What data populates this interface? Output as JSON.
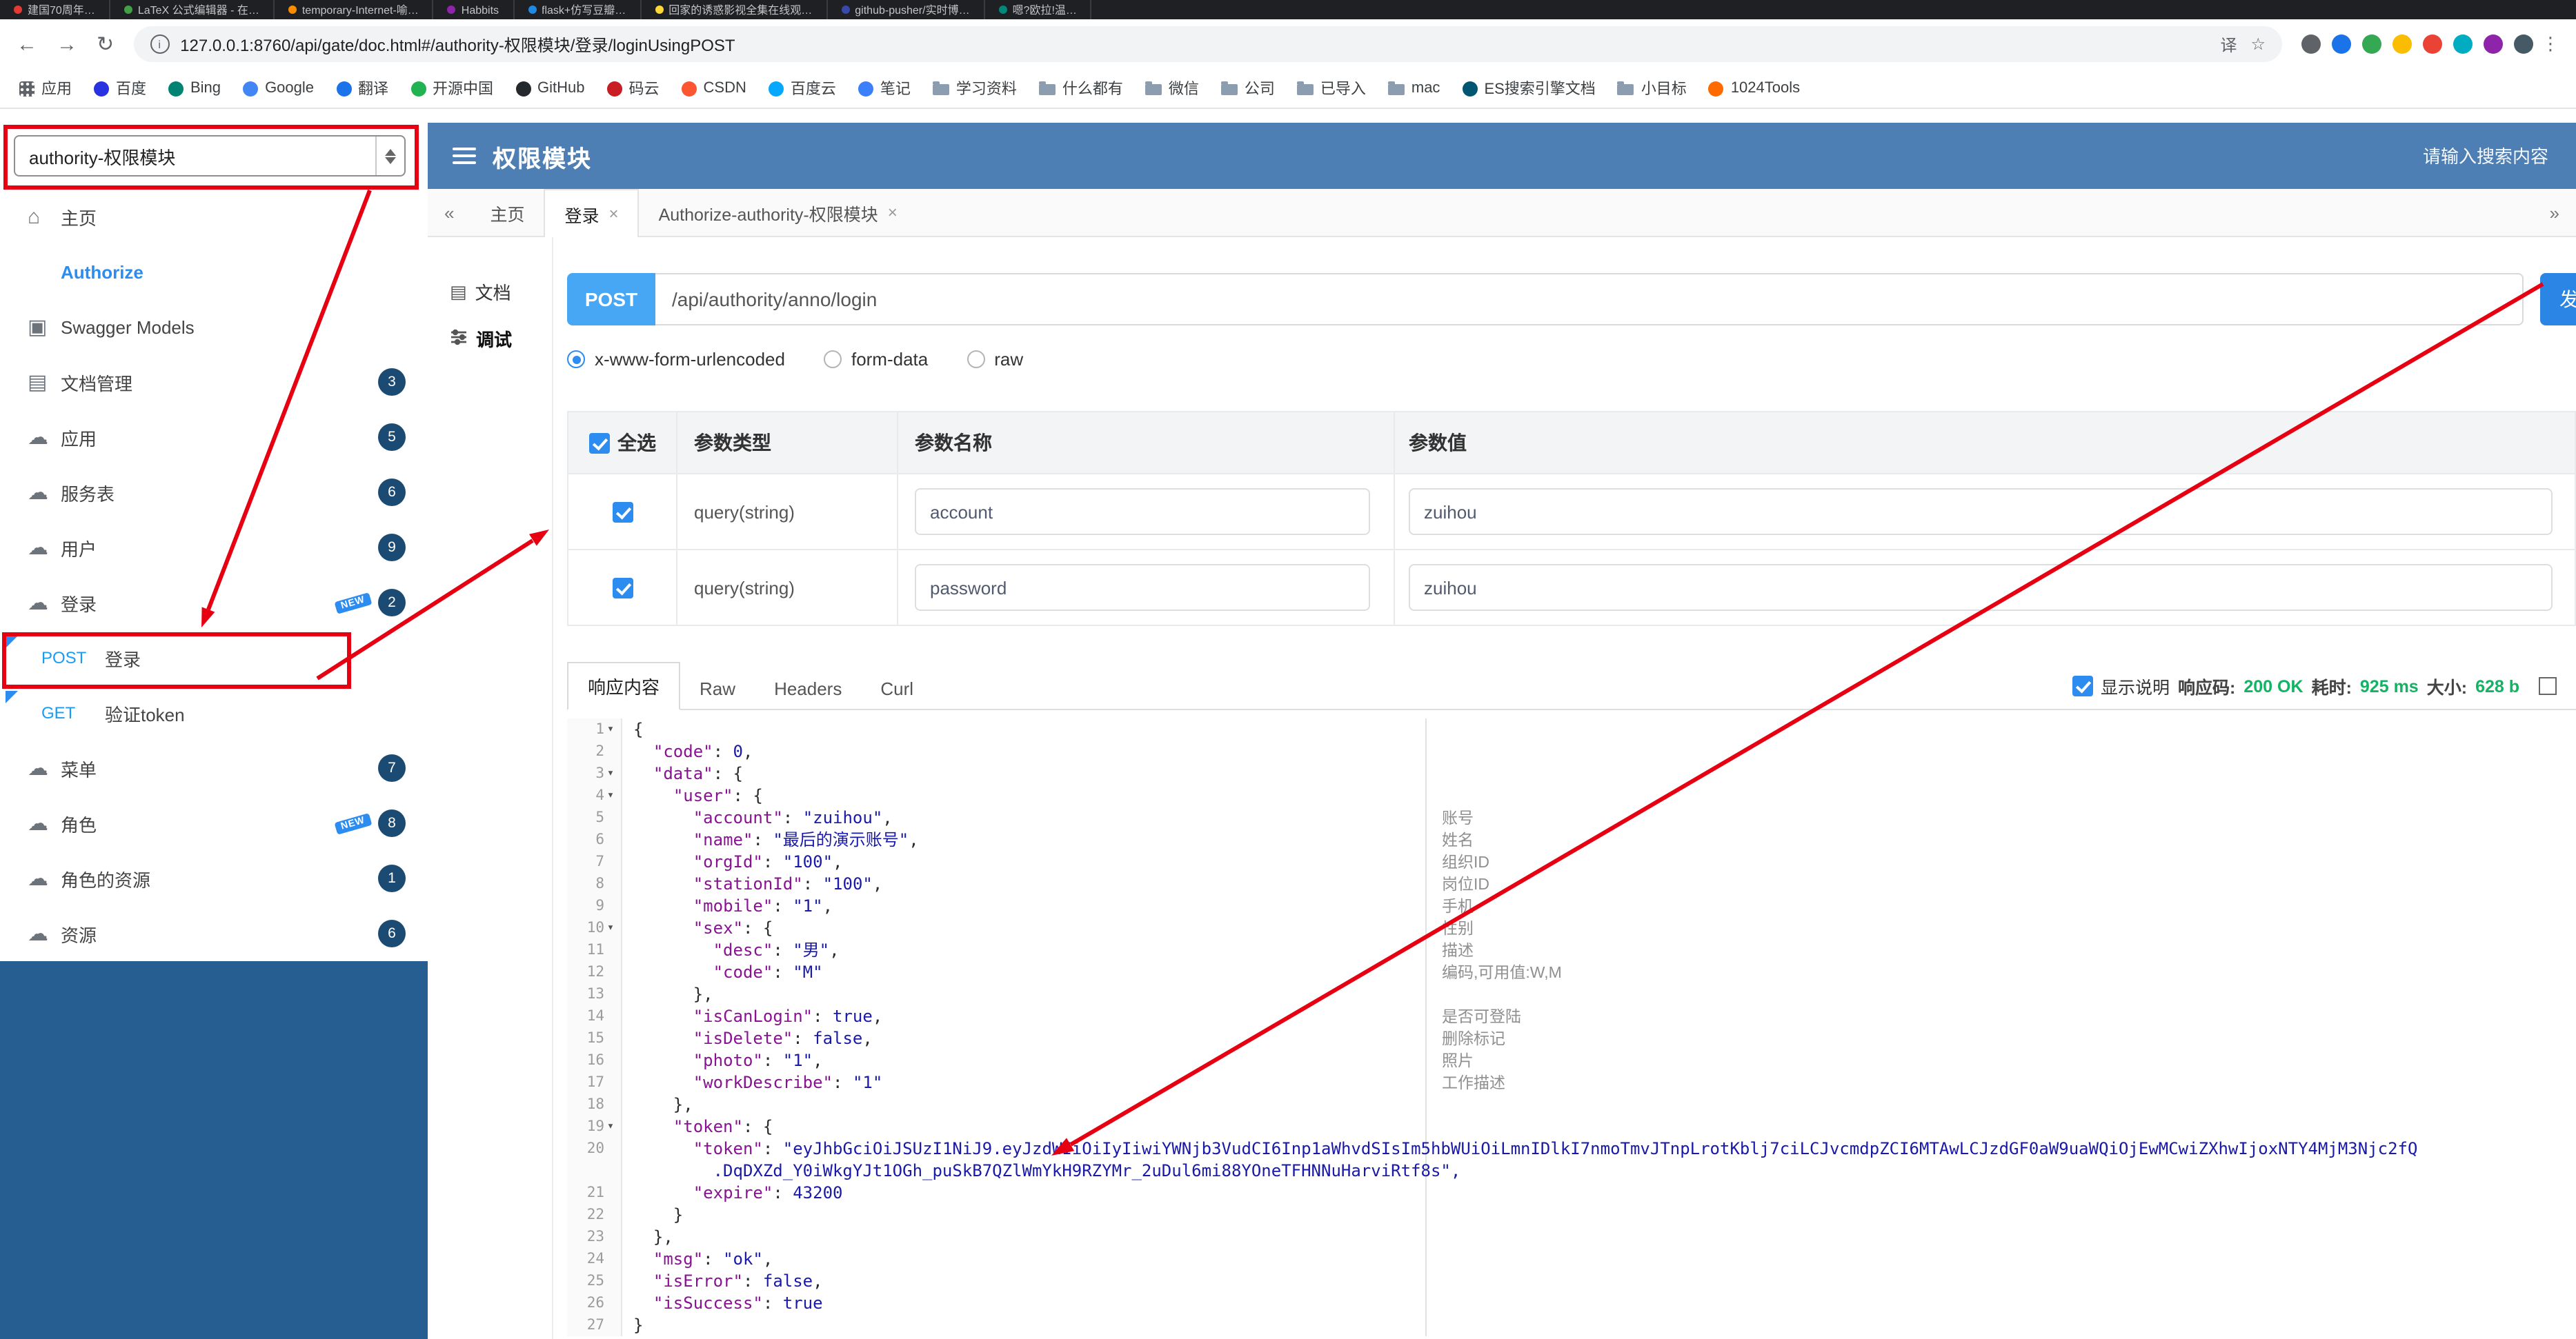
{
  "colors": {
    "header_blue": "#4e7fb4",
    "sidebar_fill": "#275e91",
    "accent": "#2d8cf0",
    "post_badge": "#47a7f5",
    "send_button": "#2b85e4",
    "success_green": "#12b362",
    "annotation_red": "#e60012",
    "badge_navy": "#1b4a72"
  },
  "browser": {
    "tabs": [
      {
        "title": "建国70周年…",
        "color": "#e53935"
      },
      {
        "title": "LaTeX 公式编辑器 - 在…",
        "color": "#43a047"
      },
      {
        "title": "temporary-Internet-喻…",
        "color": "#fb8c00"
      },
      {
        "title": "Habbits",
        "color": "#8e24aa"
      },
      {
        "title": "flask+仿写豆瓣…",
        "color": "#1e88e5"
      },
      {
        "title": "回家的诱惑影视全集在线观…",
        "color": "#fdd835"
      },
      {
        "title": "github-pusher/实时博…",
        "color": "#3949ab"
      },
      {
        "title": "嗯?欧拉!温…",
        "color": "#00897b"
      }
    ],
    "nav": {
      "back": "←",
      "forward": "→",
      "reload": "↻",
      "info": "i",
      "translate": "译",
      "star": "☆",
      "menu": "⋮"
    },
    "url": "127.0.0.1:8760/api/gate/doc.html#/authority-权限模块/登录/loginUsingPOST",
    "ext_icons": [
      "#5f6368",
      "#1a73e8",
      "#34a853",
      "#fbbc04",
      "#ea4335",
      "#00acc1",
      "#8e24aa",
      "#455a64"
    ],
    "bookmarks": [
      {
        "label": "应用",
        "icon": "grid"
      },
      {
        "label": "百度",
        "icon": "dot",
        "color": "#2932e1"
      },
      {
        "label": "Bing",
        "icon": "dot",
        "color": "#008373"
      },
      {
        "label": "Google",
        "icon": "dot",
        "color": "#4285f4"
      },
      {
        "label": "翻译",
        "icon": "dot",
        "color": "#1a73e8"
      },
      {
        "label": "开源中国",
        "icon": "dot",
        "color": "#21b351"
      },
      {
        "label": "GitHub",
        "icon": "dot",
        "color": "#24292e"
      },
      {
        "label": "码云",
        "icon": "dot",
        "color": "#c71d23"
      },
      {
        "label": "CSDN",
        "icon": "dot",
        "color": "#fc5531"
      },
      {
        "label": "百度云",
        "icon": "dot",
        "color": "#06a7ff"
      },
      {
        "label": "笔记",
        "icon": "dot",
        "color": "#3b7ffb"
      },
      {
        "label": "学习资料",
        "icon": "folder"
      },
      {
        "label": "什么都有",
        "icon": "folder"
      },
      {
        "label": "微信",
        "icon": "folder"
      },
      {
        "label": "公司",
        "icon": "folder"
      },
      {
        "label": "已导入",
        "icon": "folder"
      },
      {
        "label": "mac",
        "icon": "folder"
      },
      {
        "label": "ES搜索引擎文档",
        "icon": "dot",
        "color": "#005571"
      },
      {
        "label": "小目标",
        "icon": "folder"
      },
      {
        "label": "1024Tools",
        "icon": "dot",
        "color": "#ff6a00"
      }
    ]
  },
  "header": {
    "select_value": "authority-权限模块",
    "title": "权限模块",
    "search_placeholder": "请输入搜索内容"
  },
  "sidebar": {
    "new_label": "NEW",
    "items": [
      {
        "label": "主页"
      },
      {
        "label": "Authorize"
      },
      {
        "label": "Swagger Models"
      },
      {
        "label": "文档管理",
        "badge": "3"
      },
      {
        "label": "应用",
        "badge": "5"
      },
      {
        "label": "服务表",
        "badge": "6"
      },
      {
        "label": "用户",
        "badge": "9"
      },
      {
        "label": "登录",
        "badge": "2",
        "new": true
      },
      {
        "label": "登录",
        "method": "POST"
      },
      {
        "label": "验证token",
        "method": "GET"
      },
      {
        "label": "菜单",
        "badge": "7"
      },
      {
        "label": "角色",
        "badge": "8",
        "new": true
      },
      {
        "label": "角色的资源",
        "badge": "1"
      },
      {
        "label": "资源",
        "badge": "6"
      }
    ]
  },
  "doc_tabs": {
    "prev": "«",
    "next": "»",
    "close": "×",
    "tabs": [
      {
        "label": "主页"
      },
      {
        "label": "登录"
      },
      {
        "label": "Authorize-authority-权限模块"
      }
    ]
  },
  "mini_nav": {
    "doc": "文档",
    "debug": "调试"
  },
  "debug": {
    "method": "POST",
    "url": "/api/authority/anno/login",
    "send_label": "发送",
    "body_types": [
      {
        "label": "x-www-form-urlencoded"
      },
      {
        "label": "form-data"
      },
      {
        "label": "raw"
      }
    ],
    "params_table": {
      "select_all": "全选",
      "col_type": "参数类型",
      "col_name": "参数名称",
      "col_value": "参数值",
      "rows": [
        {
          "type": "query(string)",
          "name": "account",
          "value": "zuihou"
        },
        {
          "type": "query(string)",
          "name": "password",
          "value": "zuihou"
        }
      ]
    }
  },
  "response": {
    "tabs": [
      "响应内容",
      "Raw",
      "Headers",
      "Curl"
    ],
    "show_desc_label": "显示说明",
    "status_label": "响应码:",
    "status_value": "200 OK",
    "time_label": "耗时:",
    "time_value": "925 ms",
    "size_label": "大小:",
    "size_value": "628 b"
  },
  "editor": {
    "lines": [
      {
        "n": "1",
        "code": "{",
        "fold_mark": "▾"
      },
      {
        "n": "2",
        "code": "  \"code\": 0,"
      },
      {
        "n": "3",
        "code": "  \"data\": {",
        "fold_mark": "▾"
      },
      {
        "n": "4",
        "code": "    \"user\": {",
        "fold_mark": "▾"
      },
      {
        "n": "5",
        "code": "      \"account\": \"zuihou\",",
        "comment": "账号"
      },
      {
        "n": "6",
        "code": "      \"name\": \"最后的演示账号\",",
        "comment": "姓名"
      },
      {
        "n": "7",
        "code": "      \"orgId\": \"100\",",
        "comment": "组织ID"
      },
      {
        "n": "8",
        "code": "      \"stationId\": \"100\",",
        "comment": "岗位ID"
      },
      {
        "n": "9",
        "code": "      \"mobile\": \"1\",",
        "comment": "手机"
      },
      {
        "n": "10",
        "code": "      \"sex\": {",
        "fold_mark": "▾",
        "comment": "性别"
      },
      {
        "n": "11",
        "code": "        \"desc\": \"男\",",
        "comment": "描述"
      },
      {
        "n": "12",
        "code": "        \"code\": \"M\"",
        "comment": "编码,可用值:W,M"
      },
      {
        "n": "13",
        "code": "      },"
      },
      {
        "n": "14",
        "code": "      \"isCanLogin\": true,",
        "comment": "是否可登陆"
      },
      {
        "n": "15",
        "code": "      \"isDelete\": false,",
        "comment": "删除标记"
      },
      {
        "n": "16",
        "code": "      \"photo\": \"1\",",
        "comment": "照片"
      },
      {
        "n": "17",
        "code": "      \"workDescribe\": \"1\"",
        "comment": "工作描述"
      },
      {
        "n": "18",
        "code": "    },"
      },
      {
        "n": "19",
        "code": "    \"token\": {",
        "fold_mark": "▾"
      },
      {
        "n": "20",
        "code": "      \"token\": \"eyJhbGciOiJSUzI1NiJ9.eyJzdWIiOiIyIiwiYWNjb3VudCI6Inp1aWhvdSIsIm5hbWUiOiLmnIDlkI7nmoTmvJTnpLrotKblj7ciLCJvcmdpZCI6MTAwLCJzdGF0aW9uaWQiOjEwMCwiZXhwIjoxNTY4MjM3Njc2fQ"
      },
      {
        "n": "",
        "code": "        .DqDXZd_Y0iWkgYJt1OGh_puSkB7QZlWmYkH9RZYMr_2uDul6mi88YOneTFHNNuHarviRtf8s\",",
        "cls": "s"
      },
      {
        "n": "21",
        "code": "      \"expire\": 43200"
      },
      {
        "n": "22",
        "code": "    }"
      },
      {
        "n": "23",
        "code": "  },"
      },
      {
        "n": "24",
        "code": "  \"msg\": \"ok\","
      },
      {
        "n": "25",
        "code": "  \"isError\": false,"
      },
      {
        "n": "26",
        "code": "  \"isSuccess\": true"
      },
      {
        "n": "27",
        "code": "}"
      }
    ]
  }
}
